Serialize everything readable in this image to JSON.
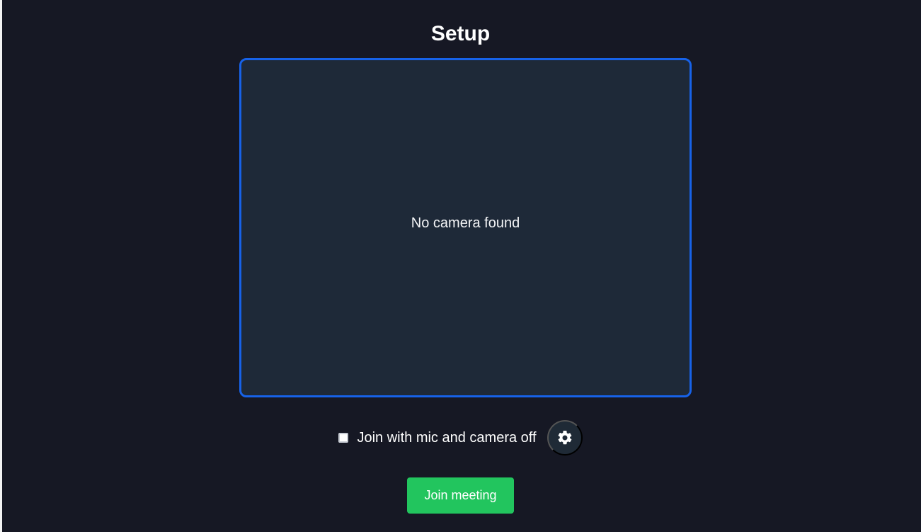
{
  "page": {
    "title": "Setup"
  },
  "preview": {
    "message": "No camera found",
    "border_color": "#1762e8",
    "background_color": "#1e2938"
  },
  "options": {
    "checkbox_label": "Join with mic and camera off",
    "checkbox_checked": false,
    "settings_icon": "gear-icon"
  },
  "actions": {
    "join_label": "Join meeting",
    "join_color": "#22c55e"
  },
  "theme": {
    "background": "#161824",
    "text": "#ffffff"
  }
}
